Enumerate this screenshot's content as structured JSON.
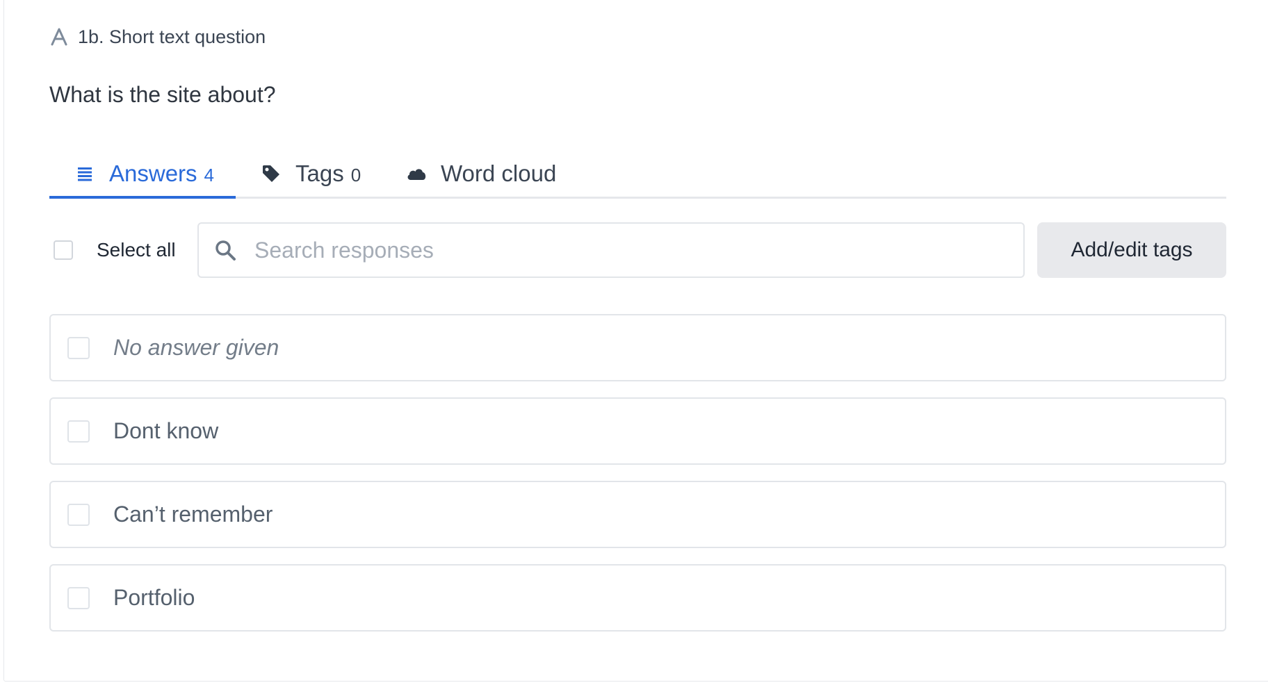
{
  "question": {
    "type_icon": "letter-a-icon",
    "type_label": "1b. Short text question",
    "text": "What is the site about?"
  },
  "tabs": [
    {
      "label": "Answers",
      "count": "4",
      "icon": "list-icon",
      "active": true
    },
    {
      "label": "Tags",
      "count": "0",
      "icon": "tag-icon",
      "active": false
    },
    {
      "label": "Word cloud",
      "count": "",
      "icon": "cloud-icon",
      "active": false
    }
  ],
  "toolbar": {
    "select_all_label": "Select all",
    "search_placeholder": "Search responses",
    "search_value": "",
    "add_tags_label": "Add/edit tags"
  },
  "answers": [
    {
      "text": "No answer given",
      "empty": true,
      "checked": false
    },
    {
      "text": "Dont know",
      "empty": false,
      "checked": false
    },
    {
      "text": "Can’t remember",
      "empty": false,
      "checked": false
    },
    {
      "text": "Portfolio",
      "empty": false,
      "checked": false
    }
  ],
  "colors": {
    "accent": "#2a6ad9",
    "border": "#e2e5e9",
    "button_bg": "#e8e9ec"
  }
}
